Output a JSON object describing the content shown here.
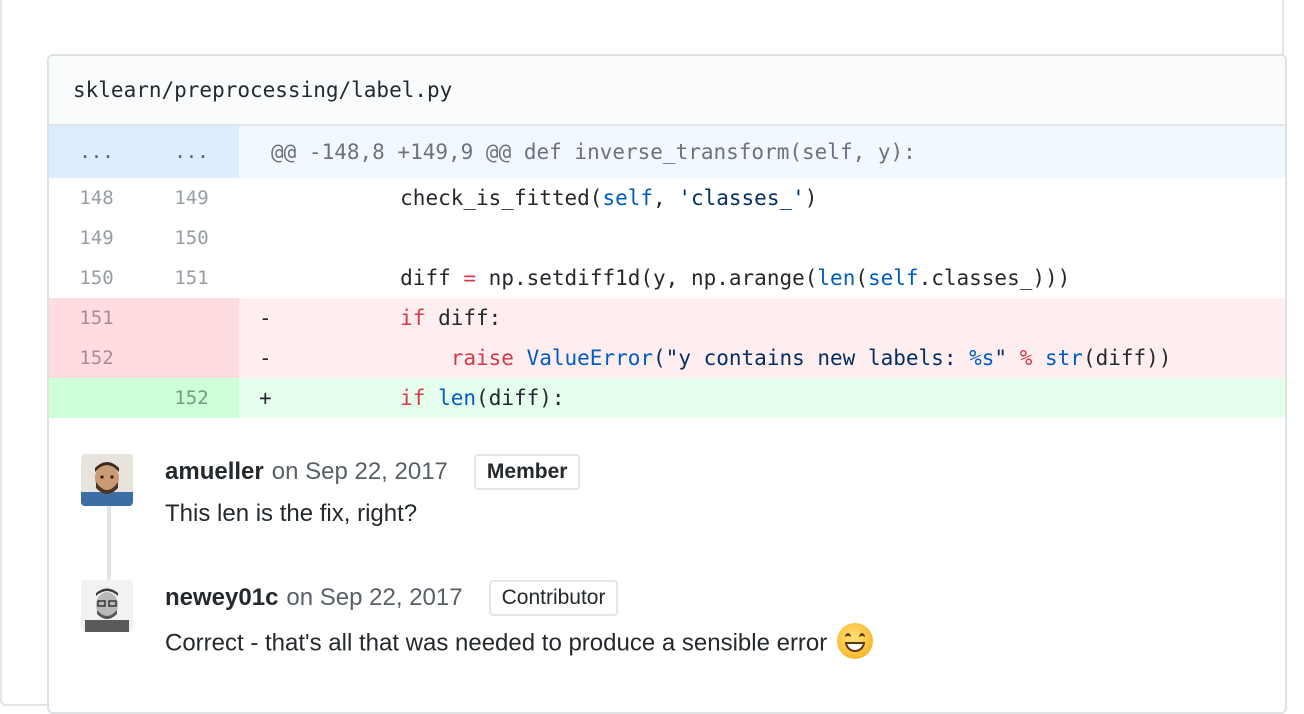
{
  "file": {
    "path": "sklearn/preprocessing/label.py"
  },
  "diff": {
    "hunk": {
      "old": "...",
      "new": "...",
      "text": "@@ -148,8 +149,9 @@ def inverse_transform(self, y):"
    },
    "lines": [
      {
        "type": "ctx",
        "old": "148",
        "new": "149",
        "marker": "",
        "indent": "        ",
        "tokens": [
          {
            "t": "check_is_fitted(",
            "c": ""
          },
          {
            "t": "self",
            "c": "bl"
          },
          {
            "t": ", ",
            "c": ""
          },
          {
            "t": "'classes_'",
            "c": "str"
          },
          {
            "t": ")",
            "c": ""
          }
        ]
      },
      {
        "type": "ctx",
        "old": "149",
        "new": "150",
        "marker": "",
        "indent": "",
        "tokens": []
      },
      {
        "type": "ctx",
        "old": "150",
        "new": "151",
        "marker": "",
        "indent": "        ",
        "tokens": [
          {
            "t": "diff ",
            "c": ""
          },
          {
            "t": "=",
            "c": "kw"
          },
          {
            "t": " np.setdiff1d(y, np.arange(",
            "c": ""
          },
          {
            "t": "len",
            "c": "bl"
          },
          {
            "t": "(",
            "c": ""
          },
          {
            "t": "self",
            "c": "bl"
          },
          {
            "t": ".classes_)))",
            "c": ""
          }
        ]
      },
      {
        "type": "del",
        "old": "151",
        "new": "",
        "marker": "-",
        "indent": "        ",
        "tokens": [
          {
            "t": "if",
            "c": "kw"
          },
          {
            "t": " diff:",
            "c": ""
          }
        ]
      },
      {
        "type": "del",
        "old": "152",
        "new": "",
        "marker": "-",
        "indent": "            ",
        "tokens": [
          {
            "t": "raise",
            "c": "kw"
          },
          {
            "t": " ",
            "c": ""
          },
          {
            "t": "ValueError",
            "c": "bl"
          },
          {
            "t": "(\"y contains new labels: ",
            "c": "str"
          },
          {
            "t": "%s",
            "c": "bl"
          },
          {
            "t": "\" ",
            "c": "str"
          },
          {
            "t": "%",
            "c": "kw"
          },
          {
            "t": " ",
            "c": ""
          },
          {
            "t": "str",
            "c": "bl"
          },
          {
            "t": "(diff))",
            "c": ""
          }
        ]
      },
      {
        "type": "add",
        "old": "",
        "new": "152",
        "marker": "+",
        "indent": "        ",
        "tokens": [
          {
            "t": "if",
            "c": "kw"
          },
          {
            "t": " ",
            "c": ""
          },
          {
            "t": "len",
            "c": "bl"
          },
          {
            "t": "(diff):",
            "c": ""
          }
        ]
      }
    ]
  },
  "comments": [
    {
      "author": "amueller",
      "date_prefix": "on",
      "date": "Sep 22, 2017",
      "badge": "Member",
      "body": "This len is the fix, right?",
      "avatar_icon": "user-avatar-bearded"
    },
    {
      "author": "newey01c",
      "date_prefix": "on",
      "date": "Sep 22, 2017",
      "badge": "Contributor",
      "body": "Correct - that's all that was needed to produce a sensible error",
      "emoji": "smile-emoji",
      "avatar_icon": "user-avatar-glasses"
    }
  ],
  "colors": {
    "deletion_bg": "#ffeef0",
    "addition_bg": "#e6ffed",
    "hunk_bg": "#f1f8ff"
  }
}
